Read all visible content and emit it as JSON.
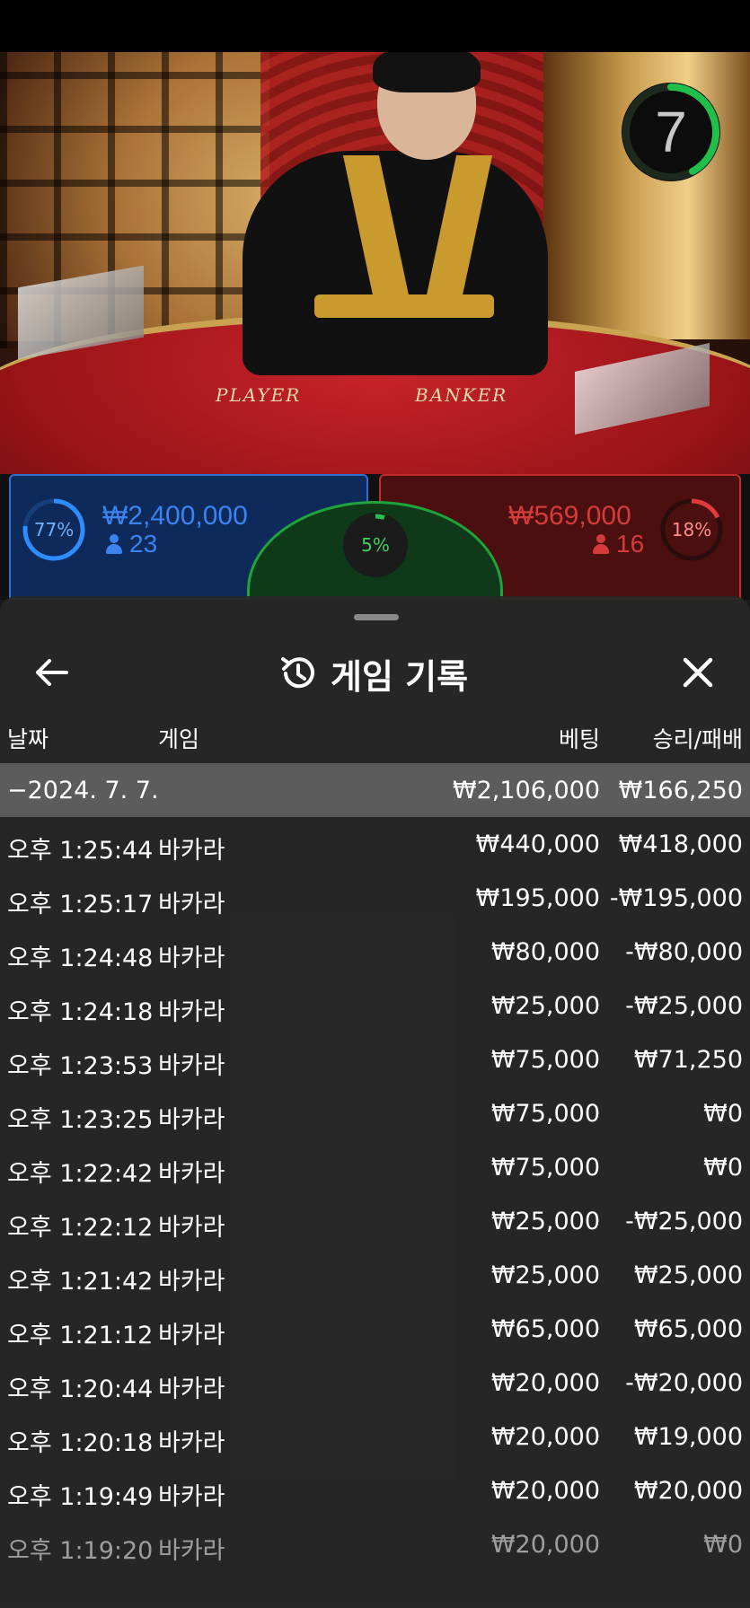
{
  "timer": {
    "value": "7"
  },
  "video": {
    "label_player": "PLAYER",
    "label_banker": "BANKER"
  },
  "stats": {
    "player": {
      "percent": "77%",
      "amount": "₩2,400,000",
      "count": "23",
      "fraction": 0.77
    },
    "tie": {
      "percent": "5%",
      "fraction": 0.05
    },
    "banker": {
      "percent": "18%",
      "amount": "₩569,000",
      "count": "16",
      "fraction": 0.18
    }
  },
  "colors": {
    "player_blue": "#2f6fd1",
    "banker_red": "#c22d2d",
    "tie_green": "#1fa43b",
    "timer_green": "#1fbf4a"
  },
  "history": {
    "title": "게임 기록",
    "title_icon": "history-icon",
    "back_icon": "arrow-left-icon",
    "close_icon": "close-icon",
    "columns": {
      "date": "날짜",
      "game": "게임",
      "bet": "베팅",
      "result": "승리/패배"
    },
    "date_row": {
      "label": "−2024. 7. 7.",
      "bet": "₩2,106,000",
      "result": "₩166,250"
    },
    "rows": [
      {
        "time": "오후 1:25:44",
        "game": "바카라",
        "bet": "₩440,000",
        "result": "₩418,000"
      },
      {
        "time": "오후 1:25:17",
        "game": "바카라",
        "bet": "₩195,000",
        "result": "-₩195,000"
      },
      {
        "time": "오후 1:24:48",
        "game": "바카라",
        "bet": "₩80,000",
        "result": "-₩80,000"
      },
      {
        "time": "오후 1:24:18",
        "game": "바카라",
        "bet": "₩25,000",
        "result": "-₩25,000"
      },
      {
        "time": "오후 1:23:53",
        "game": "바카라",
        "bet": "₩75,000",
        "result": "₩71,250"
      },
      {
        "time": "오후 1:23:25",
        "game": "바카라",
        "bet": "₩75,000",
        "result": "₩0"
      },
      {
        "time": "오후 1:22:42",
        "game": "바카라",
        "bet": "₩75,000",
        "result": "₩0"
      },
      {
        "time": "오후 1:22:12",
        "game": "바카라",
        "bet": "₩25,000",
        "result": "-₩25,000"
      },
      {
        "time": "오후 1:21:42",
        "game": "바카라",
        "bet": "₩25,000",
        "result": "₩25,000"
      },
      {
        "time": "오후 1:21:12",
        "game": "바카라",
        "bet": "₩65,000",
        "result": "₩65,000"
      },
      {
        "time": "오후 1:20:44",
        "game": "바카라",
        "bet": "₩20,000",
        "result": "-₩20,000"
      },
      {
        "time": "오후 1:20:18",
        "game": "바카라",
        "bet": "₩20,000",
        "result": "₩19,000"
      },
      {
        "time": "오후 1:19:49",
        "game": "바카라",
        "bet": "₩20,000",
        "result": "₩20,000"
      },
      {
        "time": "오후 1:19:20",
        "game": "바카라",
        "bet": "₩20,000",
        "result": "₩0"
      }
    ]
  }
}
